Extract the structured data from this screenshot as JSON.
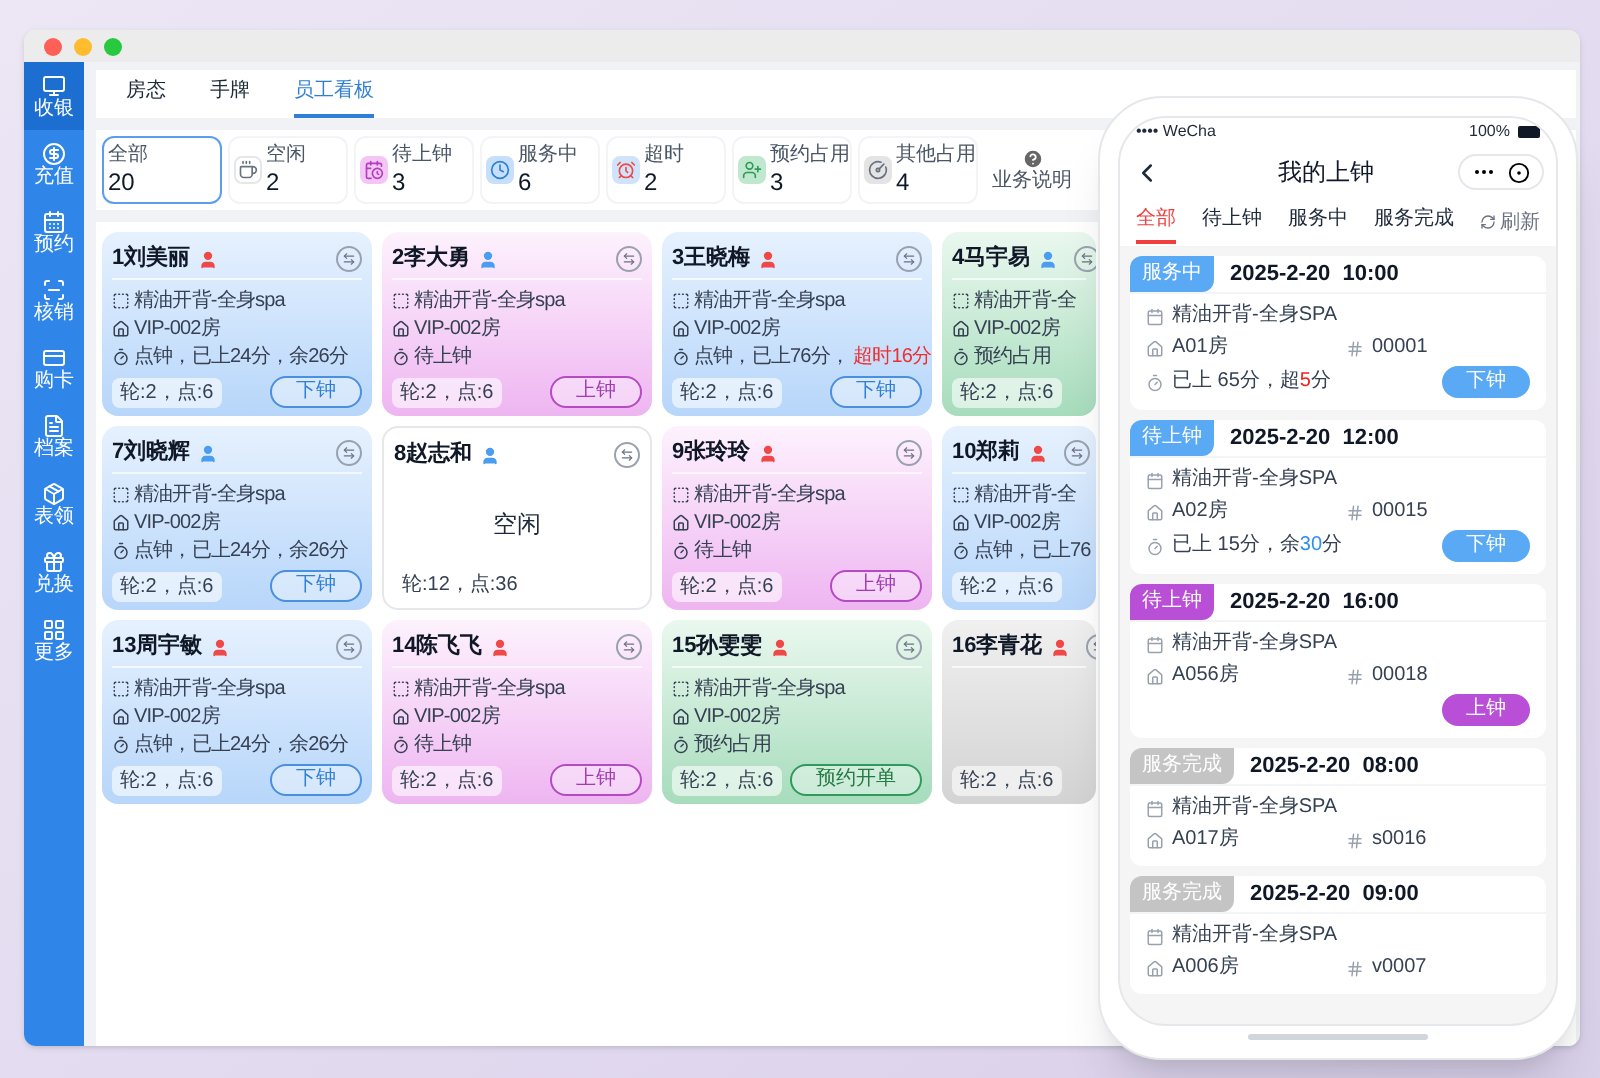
{
  "sidebar": {
    "items": [
      {
        "label": "收银",
        "selected": true
      },
      {
        "label": "充值",
        "selected": false
      },
      {
        "label": "预约",
        "selected": false
      },
      {
        "label": "核销",
        "selected": false
      },
      {
        "label": "购卡",
        "selected": false
      },
      {
        "label": "档案",
        "selected": false
      },
      {
        "label": "表领",
        "selected": false
      },
      {
        "label": "兑换",
        "selected": false
      },
      {
        "label": "更多",
        "selected": false
      }
    ]
  },
  "tabs": [
    {
      "label": "房态",
      "selected": false
    },
    {
      "label": "手牌",
      "selected": false
    },
    {
      "label": "员工看板",
      "selected": true
    }
  ],
  "stats": [
    {
      "label": "全部",
      "value": "20",
      "kind": "all",
      "selected": true
    },
    {
      "label": "空闲",
      "value": "2",
      "kind": "idle",
      "selected": false
    },
    {
      "label": "待上钟",
      "value": "3",
      "kind": "waiting",
      "selected": false
    },
    {
      "label": "服务中",
      "value": "6",
      "kind": "serving",
      "selected": false
    },
    {
      "label": "超时",
      "value": "2",
      "kind": "overtime",
      "selected": false
    },
    {
      "label": "预约占用",
      "value": "3",
      "kind": "reserved",
      "selected": false
    },
    {
      "label": "其他占用",
      "value": "4",
      "kind": "other",
      "selected": false
    }
  ],
  "help": {
    "label": "业务说明"
  },
  "cards": [
    {
      "name": "1刘美丽",
      "color": "#f04848",
      "kind": "serving",
      "service": "精油开背-全身spa",
      "room": "VIP-002房",
      "note": "点钟，已上24分，余26分",
      "stats": "轮:2，点:6",
      "button": "下钟"
    },
    {
      "name": "2李大勇",
      "color": "#4a9df0",
      "kind": "waiting",
      "service": "精油开背-全身spa",
      "room": "VIP-002房",
      "note": "待上钟",
      "stats": "轮:2，点:6",
      "button": "上钟"
    },
    {
      "name": "3王晓梅",
      "color": "#f04848",
      "kind": "serving",
      "service": "精油开背-全身spa",
      "room": "VIP-002房",
      "note": "点钟，已上76分，",
      "alert": "超时16分",
      "stats": "轮:2，点:6",
      "button": "下钟"
    },
    {
      "name": "4马宇易",
      "color": "#4a9df0",
      "kind": "reserved",
      "service": "精油开背-全",
      "room": "VIP-002房",
      "note": "预约占用",
      "stats": "轮:2，点:6"
    },
    {
      "name": "7刘晓辉",
      "color": "#4a9df0",
      "kind": "serving",
      "service": "精油开背-全身spa",
      "room": "VIP-002房",
      "note": "点钟，已上24分，余26分",
      "stats": "轮:2，点:6",
      "button": "下钟"
    },
    {
      "name": "8赵志和",
      "color": "#4a9df0",
      "kind": "idle",
      "idle_text": "空闲",
      "stats": "轮:12，点:36"
    },
    {
      "name": "9张玲玲",
      "color": "#f04848",
      "kind": "waiting",
      "service": "精油开背-全身spa",
      "room": "VIP-002房",
      "note": "待上钟",
      "stats": "轮:2，点:6",
      "button": "上钟"
    },
    {
      "name": "10郑莉",
      "color": "#f04848",
      "kind": "serving",
      "service": "精油开背-全",
      "room": "VIP-002房",
      "note": "点钟，已上76",
      "stats": "轮:2，点:6"
    },
    {
      "name": "13周宇敏",
      "color": "#f04848",
      "kind": "serving",
      "service": "精油开背-全身spa",
      "room": "VIP-002房",
      "note": "点钟，已上24分，余26分",
      "stats": "轮:2，点:6",
      "button": "下钟"
    },
    {
      "name": "14陈飞飞",
      "color": "#f04848",
      "kind": "waiting",
      "service": "精油开背-全身spa",
      "room": "VIP-002房",
      "note": "待上钟",
      "stats": "轮:2，点:6",
      "button": "上钟"
    },
    {
      "name": "15孙雯雯",
      "color": "#f04848",
      "kind": "reserved",
      "service": "精油开背-全身spa",
      "room": "VIP-002房",
      "note": "预约占用",
      "stats": "轮:2，点:6",
      "button": "预约开单"
    },
    {
      "name": "16李青花",
      "color": "#f04848",
      "kind": "other",
      "stats": "轮:2，点:6"
    }
  ],
  "phone": {
    "carrier": "•••• WeCha",
    "battery": "100%",
    "title": "我的上钟",
    "tabs": [
      {
        "label": "全部",
        "selected": true
      },
      {
        "label": "待上钟",
        "selected": false
      },
      {
        "label": "服务中",
        "selected": false
      },
      {
        "label": "服务完成",
        "selected": false
      }
    ],
    "refresh": "刷新",
    "orders": [
      {
        "badge": "服务中",
        "color": "#5aa9f5",
        "datetime": "2025-2-20  10:00",
        "service": "精油开背-全身SPA",
        "room": "A01房",
        "code": "00001",
        "elapsed": "已上 65分，超",
        "highlight": "5",
        "kind": "over",
        "tail": "分",
        "button": "下钟"
      },
      {
        "badge": "待上钟",
        "color": "#5aa9f5",
        "datetime": "2025-2-20  12:00",
        "service": "精油开背-全身SPA",
        "room": "A02房",
        "code": "00015",
        "elapsed": "已上 15分，余",
        "highlight": "30",
        "kind": "remain",
        "tail": "分",
        "button": "下钟"
      },
      {
        "badge": "待上钟",
        "color": "#b84fd6",
        "datetime": "2025-2-20  16:00",
        "service": "精油开背-全身SPA",
        "room": "A056房",
        "code": "00018",
        "button": "上钟"
      },
      {
        "badge": "服务完成",
        "color": "#c4c4c4",
        "datetime": "2025-2-20  08:00",
        "service": "精油开背-全身SPA",
        "room": "A017房",
        "code": "s0016"
      },
      {
        "badge": "服务完成",
        "color": "#c4c4c4",
        "datetime": "2025-2-20  09:00",
        "service": "精油开背-全身SPA",
        "room": "A006房",
        "code": "v0007"
      }
    ]
  }
}
